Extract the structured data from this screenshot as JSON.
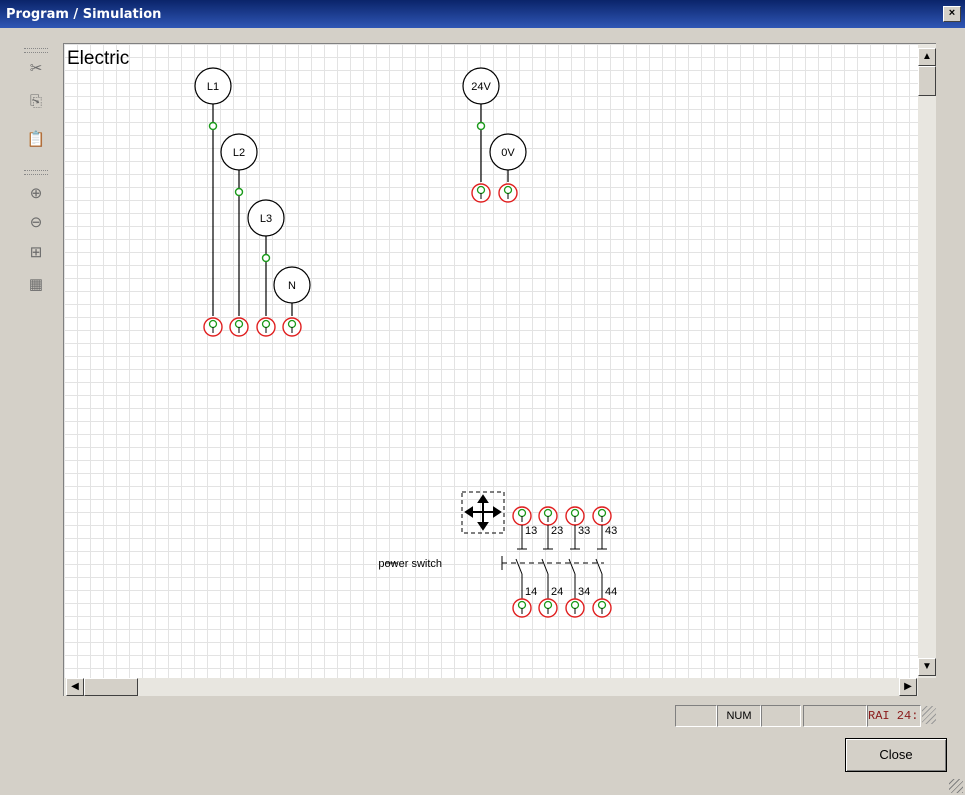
{
  "window": {
    "title": "Program / Simulation",
    "close_glyph": "×"
  },
  "toolbar": {
    "buttons": [
      {
        "name": "cut-icon",
        "glyph": "✂"
      },
      {
        "name": "copy-icon",
        "glyph": "⎘"
      },
      {
        "name": "paste-icon",
        "glyph": "📋"
      },
      {
        "name": "zoom-in-icon",
        "glyph": "⊕"
      },
      {
        "name": "zoom-out-icon",
        "glyph": "⊖"
      },
      {
        "name": "zoom-fit-icon",
        "glyph": "⊞"
      },
      {
        "name": "grid-icon",
        "glyph": "▦"
      }
    ]
  },
  "diagram": {
    "title": "Electric",
    "sources": [
      "L1",
      "L2",
      "L3",
      "N",
      "24V",
      "0V"
    ],
    "switch": {
      "label": "power switch",
      "top_terminals": [
        "13",
        "23",
        "33",
        "43"
      ],
      "bottom_terminals": [
        "14",
        "24",
        "34",
        "44"
      ]
    }
  },
  "statusbar": {
    "num": "NUM",
    "rai": "RAI 24:"
  },
  "close_label": "Close",
  "colors": {
    "terminal": "#e02020",
    "node": "#1a9a1a",
    "titlebar": "#0a246a"
  }
}
